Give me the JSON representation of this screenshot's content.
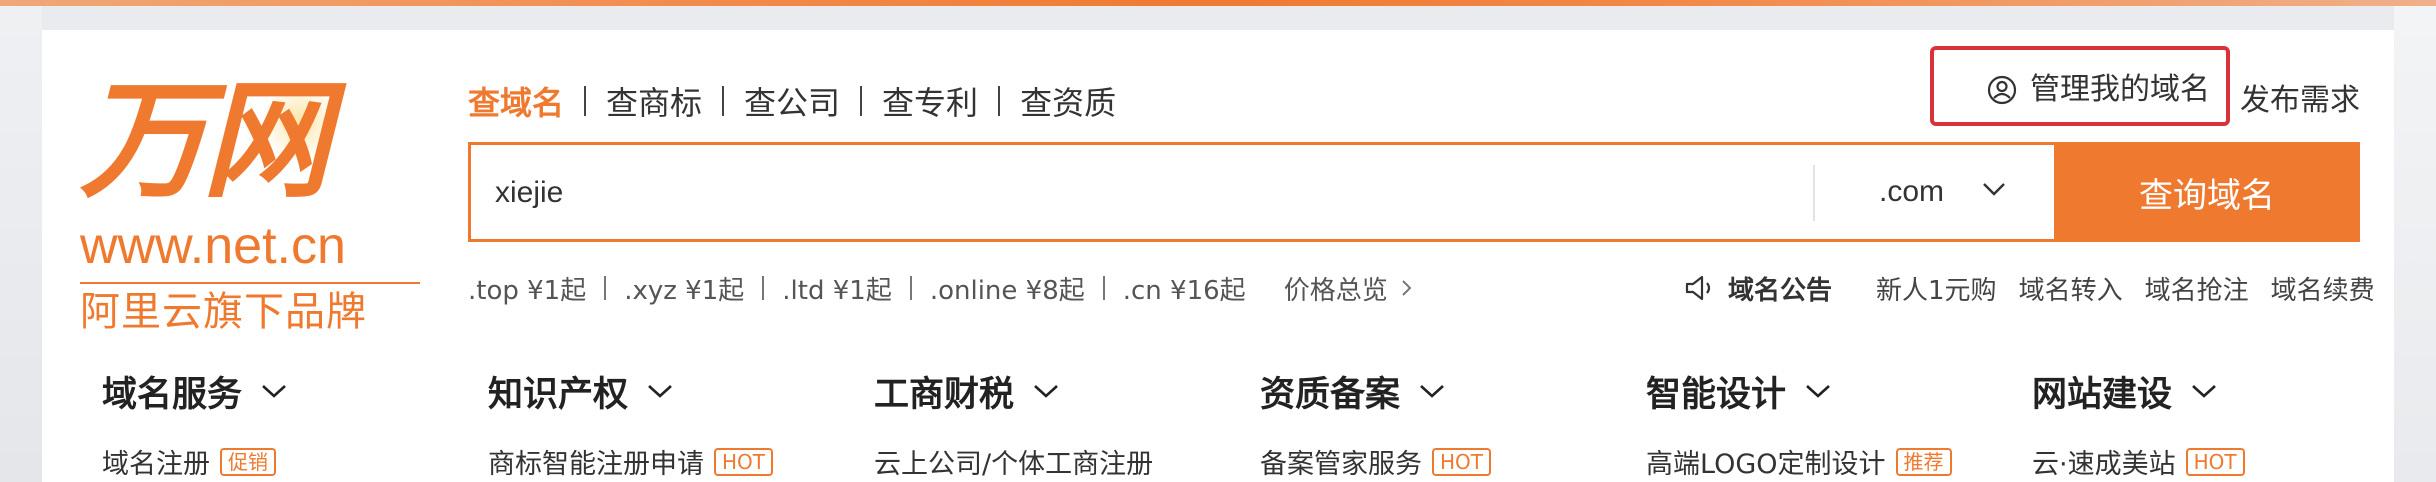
{
  "logo": {
    "mark": "万网",
    "url": "www.net.cn",
    "slogan": "阿里云旗下品牌"
  },
  "tabs": [
    "查域名",
    "查商标",
    "查公司",
    "查专利",
    "查资质"
  ],
  "manage_label": "管理我的域名",
  "publish_label": "发布需求",
  "search": {
    "value": "xiejie",
    "suffix": ".com",
    "button": "查询域名"
  },
  "prices": [
    ".top ¥1起",
    ".xyz ¥1起",
    ".ltd ¥1起",
    ".online ¥8起",
    ".cn ¥16起"
  ],
  "price_overview": "价格总览",
  "notice": {
    "title": "域名公告",
    "links": [
      "新人1元购",
      "域名转入",
      "域名抢注",
      "域名续费"
    ]
  },
  "categories": [
    {
      "title": "域名服务",
      "item": "域名注册",
      "tag": "促销"
    },
    {
      "title": "知识产权",
      "item": "商标智能注册申请",
      "tag": "HOT"
    },
    {
      "title": "工商财税",
      "item": "云上公司/个体工商注册",
      "tag": ""
    },
    {
      "title": "资质备案",
      "item": "备案管家服务",
      "tag": "HOT"
    },
    {
      "title": "智能设计",
      "item": "高端LOGO定制设计",
      "tag": "推荐"
    },
    {
      "title": "网站建设",
      "item": "云·速成美站",
      "tag": "HOT"
    }
  ],
  "colors": {
    "accent": "#ef7a2f",
    "highlight_border": "#d9323b"
  }
}
